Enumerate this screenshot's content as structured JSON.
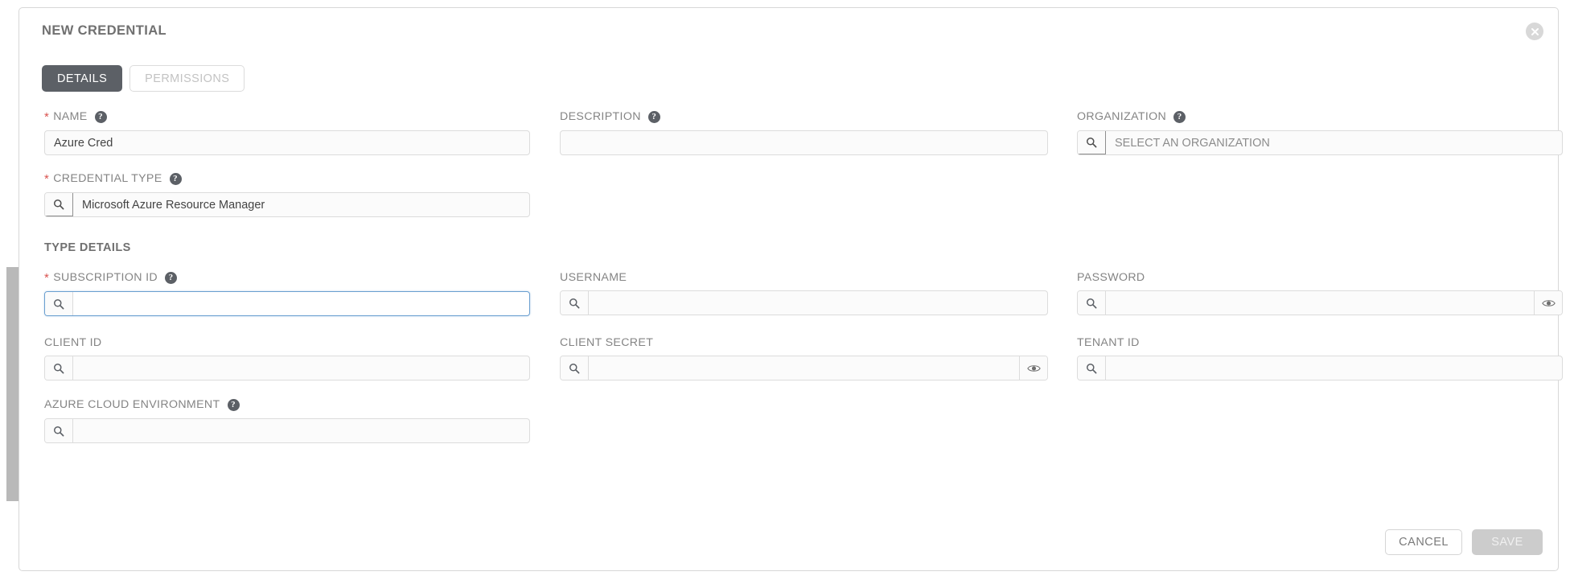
{
  "window": {
    "title": "NEW CREDENTIAL",
    "close_icon": "close-circle-icon"
  },
  "tabs": [
    {
      "label": "DETAILS",
      "active": true
    },
    {
      "label": "PERMISSIONS",
      "active": false
    }
  ],
  "sections": {
    "type_details_heading": "TYPE DETAILS"
  },
  "fields": {
    "name": {
      "label": "NAME",
      "required": true,
      "help": true,
      "value": "Azure Cred",
      "placeholder": "",
      "search_icon": false
    },
    "description": {
      "label": "DESCRIPTION",
      "required": false,
      "help": true,
      "value": "",
      "placeholder": "",
      "search_icon": false
    },
    "organization": {
      "label": "ORGANIZATION",
      "required": false,
      "help": true,
      "value": "",
      "placeholder": "SELECT AN ORGANIZATION",
      "search_icon": true
    },
    "credential_type": {
      "label": "CREDENTIAL TYPE",
      "required": true,
      "help": true,
      "value": "Microsoft Azure Resource Manager",
      "placeholder": "",
      "search_icon": true
    },
    "subscription_id": {
      "label": "SUBSCRIPTION ID",
      "required": true,
      "help": true,
      "value": "",
      "placeholder": "",
      "search_icon": true,
      "focused": true
    },
    "username": {
      "label": "USERNAME",
      "required": false,
      "help": false,
      "value": "",
      "placeholder": "",
      "search_icon": true
    },
    "password": {
      "label": "PASSWORD",
      "required": false,
      "help": false,
      "value": "",
      "placeholder": "",
      "search_icon": true,
      "reveal_icon": "eye-icon"
    },
    "client_id": {
      "label": "CLIENT ID",
      "required": false,
      "help": false,
      "value": "",
      "placeholder": "",
      "search_icon": true
    },
    "client_secret": {
      "label": "CLIENT SECRET",
      "required": false,
      "help": false,
      "value": "",
      "placeholder": "",
      "search_icon": true,
      "reveal_icon": "eye-icon"
    },
    "tenant_id": {
      "label": "TENANT ID",
      "required": false,
      "help": false,
      "value": "",
      "placeholder": "",
      "search_icon": true
    },
    "azure_cloud_environment": {
      "label": "AZURE CLOUD ENVIRONMENT",
      "required": false,
      "help": true,
      "value": "",
      "placeholder": "",
      "search_icon": true
    }
  },
  "footer": {
    "cancel_label": "CANCEL",
    "save_label": "SAVE",
    "save_disabled": true
  },
  "help_glyph": "?",
  "required_glyph": "*",
  "colors": {
    "accent_tab_active": "#5c6066",
    "required_asterisk": "#d9534f",
    "label_text": "#848484",
    "focus_border": "#6a9fd0",
    "save_disabled_bg": "#cccccc",
    "scrollbar_thumb": "#b9b9b9"
  }
}
